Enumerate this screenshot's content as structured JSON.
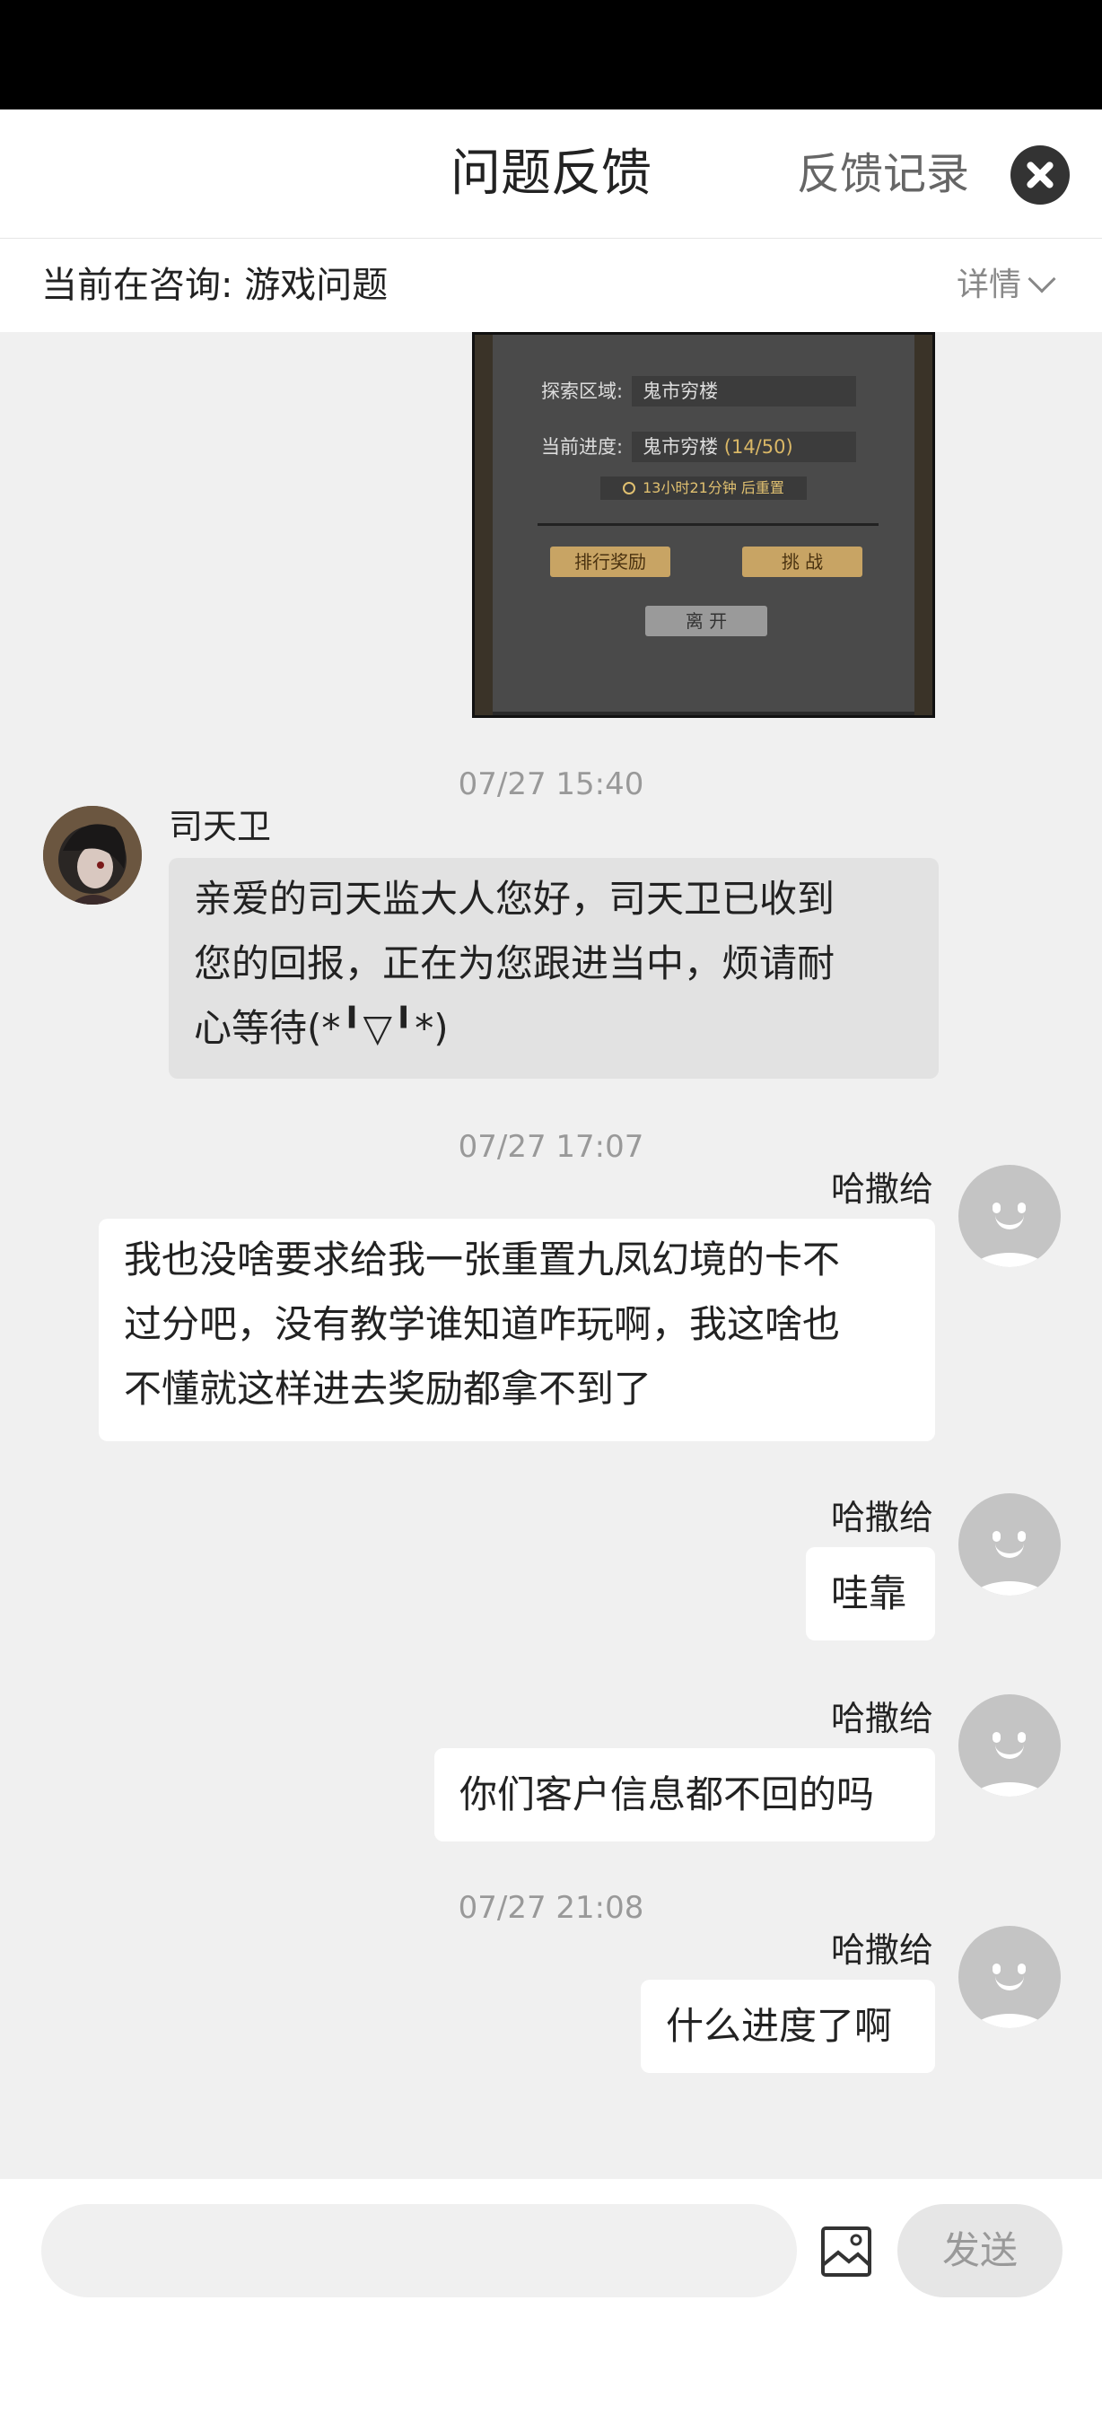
{
  "header": {
    "title": "问题反馈",
    "records_link": "反馈记录"
  },
  "consult": {
    "label": "当前在咨询:  游戏问题",
    "details": "详情"
  },
  "game_screenshot": {
    "area_label": "探索区域:",
    "area_value": "鬼市穷楼",
    "progress_label": "当前进度:",
    "progress_value": "鬼市穷楼",
    "progress_count": "(14/50)",
    "timer": "13小时21分钟 后重置",
    "rank_button": "排行奖励",
    "challenge_button": "挑  战",
    "leave_button": "离  开"
  },
  "messages": [
    {
      "time": "07/27 15:40",
      "sender": "司天卫",
      "role": "agent",
      "lines": [
        "亲爱的司天监大人您好，司天卫已收到",
        "您的回报，正在为您跟进当中，烦请耐",
        "心等待(*╹▽╹*)"
      ]
    },
    {
      "time": "07/27 17:07",
      "sender": "哈撒给",
      "role": "user",
      "lines": [
        "我也没啥要求给我一张重置九凤幻境的卡不",
        "过分吧，没有教学谁知道咋玩啊，我这啥也",
        "不懂就这样进去奖励都拿不到了"
      ]
    },
    {
      "sender": "哈撒给",
      "role": "user",
      "lines": [
        "哇靠"
      ]
    },
    {
      "sender": "哈撒给",
      "role": "user",
      "lines": [
        "你们客户信息都不回的吗"
      ]
    },
    {
      "time": "07/27 21:08",
      "sender": "哈撒给",
      "role": "user",
      "lines": [
        "什么进度了啊"
      ]
    }
  ],
  "composer": {
    "placeholder": "",
    "send_label": "发送"
  }
}
